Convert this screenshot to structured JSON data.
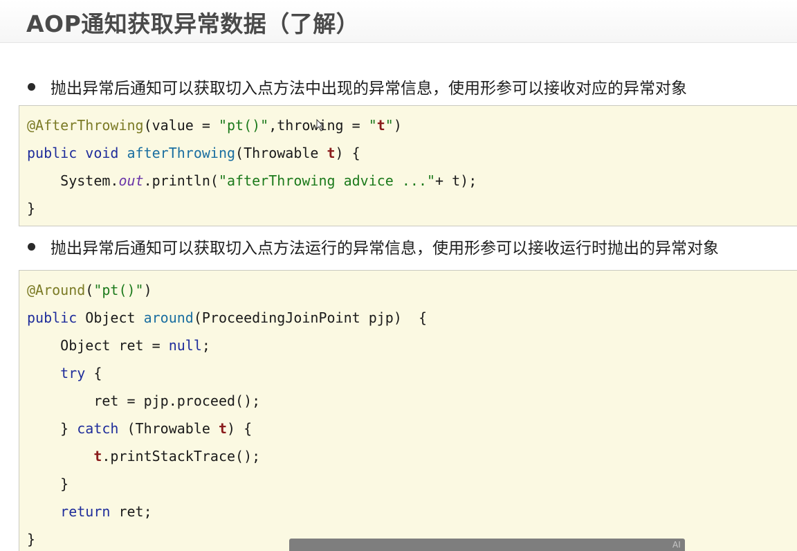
{
  "slide": {
    "title": "AOP通知获取异常数据（了解）",
    "bullets": [
      "抛出异常后通知可以获取切入点方法中出现的异常信息，使用形参可以接收对应的异常对象",
      "抛出异常后通知可以获取切入点方法运行的异常信息，使用形参可以接收运行时抛出的异常对象"
    ]
  },
  "code1": {
    "l1": {
      "ann": "@AfterThrowing",
      "a": "(value = ",
      "s1": "\"pt()\"",
      "b": ",throwing = ",
      "q1": "\"",
      "t": "t",
      "q2": "\"",
      "c": ")"
    },
    "l2": {
      "kw": "public void ",
      "m": "afterThrowing",
      "a": "(Throwable ",
      "t": "t",
      "b": ") {"
    },
    "l3": {
      "a": "    System.",
      "f": "out",
      "b": ".println(",
      "s": "\"afterThrowing advice ...\"",
      "c": "+ t);"
    },
    "l4": {
      "a": "}"
    }
  },
  "code2": {
    "l1": {
      "ann": "@Around",
      "a": "(",
      "s": "\"pt()\"",
      "b": ")"
    },
    "l2": {
      "kw": "public ",
      "a": "Object ",
      "m": "around",
      "b": "(ProceedingJoinPoint pjp)  {"
    },
    "l3": {
      "a": "    Object ret = ",
      "kw": "null",
      "b": ";"
    },
    "l4": {
      "ind": "    ",
      "kw": "try",
      "a": " {"
    },
    "l5": {
      "a": "        ret = pjp.proceed();"
    },
    "l6": {
      "a": "    } ",
      "kw": "catch",
      "b": " (Throwable ",
      "t": "t",
      "c": ") {"
    },
    "l7": {
      "ind": "        ",
      "t": "t",
      "a": ".printStackTrace();"
    },
    "l8": {
      "a": "    }"
    },
    "l9": {
      "ind": "    ",
      "kw": "return",
      "a": " ret;"
    },
    "l10": {
      "a": "}"
    }
  },
  "overlay": {
    "mark": "AI"
  }
}
